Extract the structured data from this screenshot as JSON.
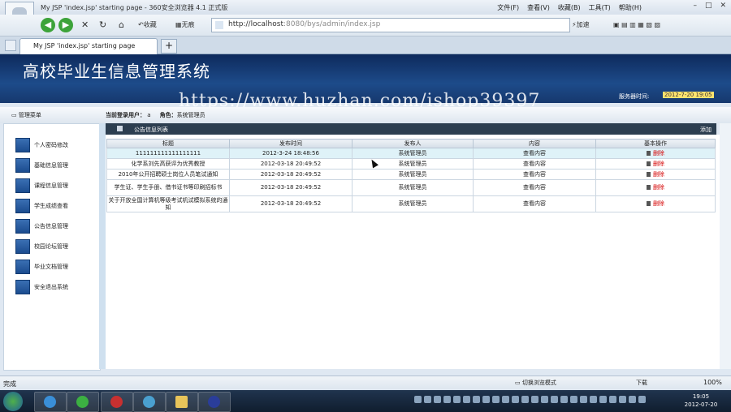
{
  "browser": {
    "window_title": "My JSP 'index.jsp' starting page - 360安全浏览器 4.1 正式版",
    "menu": [
      "文件(F)",
      "查看(V)",
      "收藏(B)",
      "工具(T)",
      "帮助(H)"
    ],
    "toolbar": {
      "favorites": "收藏",
      "apps": "无痕"
    },
    "address_host": "http://localhost",
    "address_path": ":8080/bys/admin/index.jsp",
    "accelerate": "加速",
    "tab_title": "My JSP 'index.jsp' starting page",
    "new_tab": "+",
    "status": "完成",
    "view_mode": "切换浏览模式",
    "download": "下载",
    "zoom": "100%"
  },
  "site": {
    "title": "高校毕业生信息管理系统",
    "server_time_label": "服务器时间:",
    "server_time": "2012-7-20 19:05",
    "watermark": "https://www.huzhan.com/ishop39397"
  },
  "info": {
    "menu_title": "管理菜单",
    "login_label": "当前登录用户：",
    "login_user": "a",
    "role_label": "角色：",
    "role": "系统管理员"
  },
  "sidebar": {
    "items": [
      {
        "label": "个人密码修改"
      },
      {
        "label": "基础信息管理"
      },
      {
        "label": "课程信息管理"
      },
      {
        "label": "学生成绩查看"
      },
      {
        "label": "公告信息管理"
      },
      {
        "label": "校园论坛管理"
      },
      {
        "label": "毕业文档管理"
      },
      {
        "label": "安全退出系统"
      }
    ]
  },
  "panel": {
    "title": "公告信息列表",
    "add": "添加",
    "columns": [
      "标题",
      "发布时间",
      "发布人",
      "内容",
      "基本操作"
    ],
    "rows": [
      {
        "title": "111111111111111111",
        "time": "2012-3-24 18:48:56",
        "author": "系统管理员",
        "content": "查看内容",
        "delete": "删除"
      },
      {
        "title": "化学系刘先高获评为优秀教授",
        "time": "2012-03-18 20:49:52",
        "author": "系统管理员",
        "content": "查看内容",
        "delete": "删除"
      },
      {
        "title": "2010年公开招聘硕士岗位人员笔试通知",
        "time": "2012-03-18 20:49:52",
        "author": "系统管理员",
        "content": "查看内容",
        "delete": "删除"
      },
      {
        "title": "学生证、学生手册、借书证书等印刷招标书",
        "time": "2012-03-18 20:49:52",
        "author": "系统管理员",
        "content": "查看内容",
        "delete": "删除"
      },
      {
        "title": "关于开放全国计算机等级考试机试模拟系统的通知",
        "time": "2012-03-18 20:49:52",
        "author": "系统管理员",
        "content": "查看内容",
        "delete": "删除"
      }
    ]
  },
  "taskbar": {
    "time": "19:05",
    "date": "2012-07-20"
  }
}
